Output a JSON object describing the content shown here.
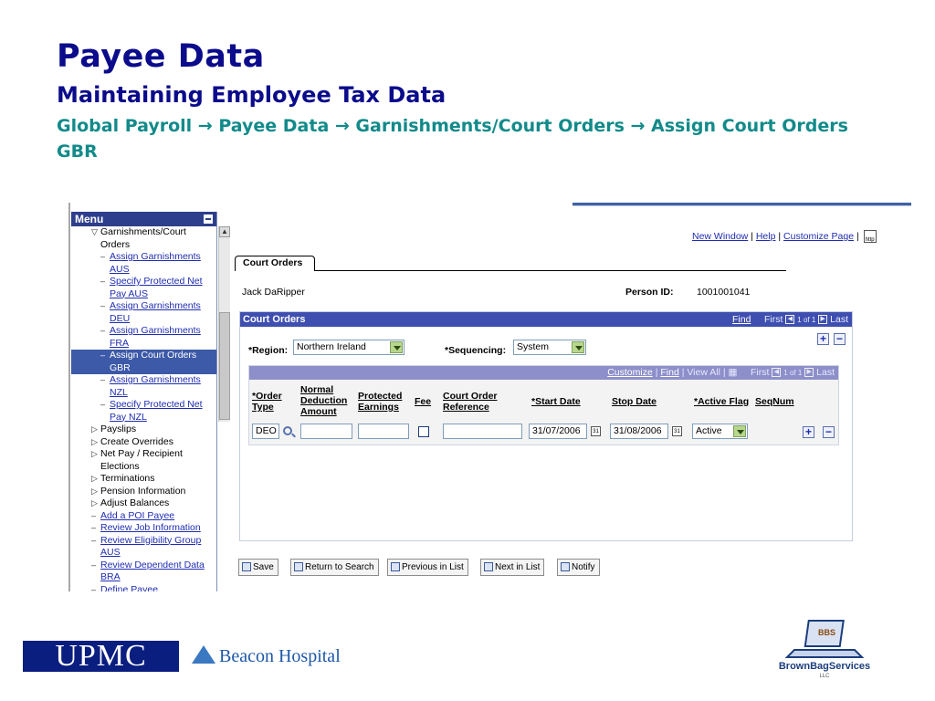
{
  "slide": {
    "title": "Payee Data",
    "subtitle": "Maintaining Employee Tax Data",
    "path": "Global Payroll → Payee Data → Garnishments/Court Orders → Assign Court Orders GBR"
  },
  "menu": {
    "header": "Menu",
    "items": [
      {
        "label": "Garnishments/Court Orders",
        "bullet": "▽",
        "link": false,
        "indent": 1
      },
      {
        "label": "Assign Garnishments AUS",
        "bullet": "–",
        "link": true,
        "indent": 2
      },
      {
        "label": "Specify Protected Net Pay AUS",
        "bullet": "–",
        "link": true,
        "indent": 2
      },
      {
        "label": "Assign Garnishments DEU",
        "bullet": "–",
        "link": true,
        "indent": 2
      },
      {
        "label": "Assign Garnishments FRA",
        "bullet": "–",
        "link": true,
        "indent": 2
      },
      {
        "label": "Assign Court Orders GBR",
        "bullet": "–",
        "link": false,
        "indent": 2,
        "selected": true
      },
      {
        "label": "Assign Garnishments NZL",
        "bullet": "–",
        "link": true,
        "indent": 2
      },
      {
        "label": "Specify Protected Net Pay NZL",
        "bullet": "–",
        "link": true,
        "indent": 2
      },
      {
        "label": "Payslips",
        "bullet": "▷",
        "link": false,
        "indent": 1
      },
      {
        "label": "Create Overrides",
        "bullet": "▷",
        "link": false,
        "indent": 1
      },
      {
        "label": "Net Pay / Recipient Elections",
        "bullet": "▷",
        "link": false,
        "indent": 1
      },
      {
        "label": "Terminations",
        "bullet": "▷",
        "link": false,
        "indent": 1
      },
      {
        "label": "Pension Information",
        "bullet": "▷",
        "link": false,
        "indent": 1
      },
      {
        "label": "Adjust Balances",
        "bullet": "▷",
        "link": false,
        "indent": 1
      },
      {
        "label": "Add a POI Payee",
        "bullet": "–",
        "link": true,
        "indent": 1
      },
      {
        "label": "Review Job Information",
        "bullet": "–",
        "link": true,
        "indent": 1
      },
      {
        "label": "Review Eligibility Group AUS",
        "bullet": "–",
        "link": true,
        "indent": 1
      },
      {
        "label": "Review Dependent Data BRA",
        "bullet": "–",
        "link": true,
        "indent": 1
      },
      {
        "label": "Define Payee",
        "bullet": "–",
        "link": true,
        "indent": 1
      }
    ]
  },
  "toplinks": {
    "new_window": "New Window",
    "help": "Help",
    "customize_page": "Customize Page",
    "http": "http"
  },
  "tab": {
    "label": "Court Orders"
  },
  "person": {
    "name": "Jack DaRipper",
    "id_label": "Person ID:",
    "id_value": "1001001041"
  },
  "panel": {
    "title": "Court Orders",
    "find": "Find",
    "first": "First",
    "count": "1 of 1",
    "last": "Last",
    "region_label": "*Region:",
    "region_value": "Northern Ireland",
    "sequencing_label": "*Sequencing:",
    "sequencing_value": "System"
  },
  "grid": {
    "customize": "Customize",
    "find": "Find",
    "view_all": "View All",
    "first": "First",
    "count": "1 of 1",
    "last": "Last",
    "columns": {
      "order_type": "*Order Type",
      "normal_deduction": "Normal Deduction Amount",
      "protected_earnings": "Protected Earnings",
      "fee": "Fee",
      "court_order_ref": "Court Order Reference",
      "start_date": "*Start Date",
      "stop_date": "Stop Date",
      "active_flag": "*Active Flag",
      "seqnum": "SeqNum"
    },
    "row": {
      "order_type": "DEO",
      "normal_deduction": "",
      "protected_earnings": "",
      "court_order_ref": "",
      "start_date": "31/07/2006",
      "stop_date": "31/08/2006",
      "active_flag": "Active"
    }
  },
  "buttons": {
    "save": "Save",
    "return_to_search": "Return to Search",
    "previous_in_list": "Previous in List",
    "next_in_list": "Next in List",
    "notify": "Notify"
  },
  "logos": {
    "upmc": "UPMC",
    "beacon": "Beacon Hospital",
    "bbs_mark": "BBS",
    "bbs_name": "BrownBagServices",
    "bbs_llc": "LLC"
  },
  "colors": {
    "title": "#0b0b8c",
    "path": "#128a8a",
    "menu_header": "#2d3e8c",
    "panel_header": "#3f4fb0",
    "grid_header": "#8c8fc9",
    "link": "#1f2db0"
  }
}
